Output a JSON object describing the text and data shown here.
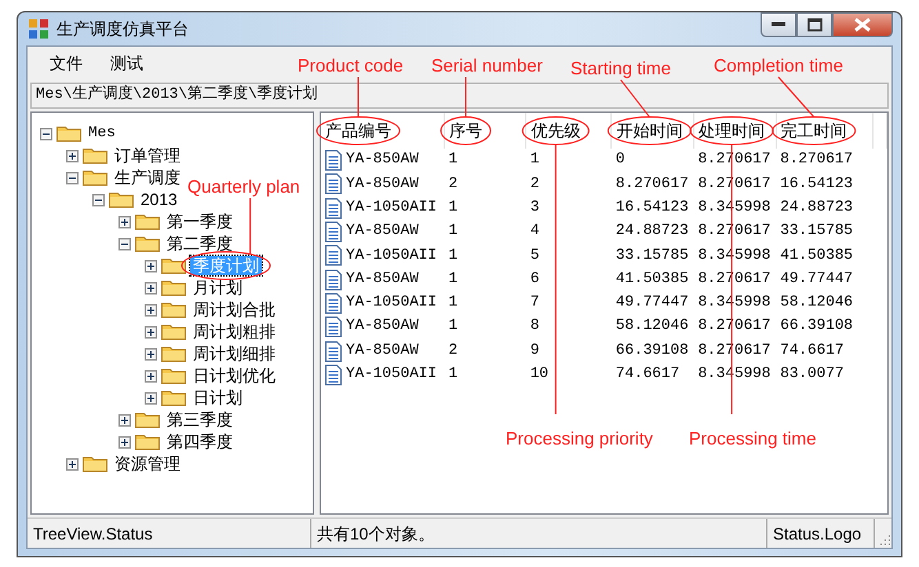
{
  "window": {
    "title": "生产调度仿真平台"
  },
  "menu": [
    "文件",
    "测试"
  ],
  "path": "Mes\\生产调度\\2013\\第二季度\\季度计划",
  "tree": [
    {
      "label": "Mes",
      "expanded": true,
      "selected": false,
      "children": [
        {
          "label": "订单管理",
          "expanded": false,
          "selected": false
        },
        {
          "label": "生产调度",
          "expanded": true,
          "selected": false,
          "children": [
            {
              "label": "2013",
              "expanded": true,
              "selected": false,
              "children": [
                {
                  "label": "第一季度",
                  "expanded": false,
                  "selected": false
                },
                {
                  "label": "第二季度",
                  "expanded": true,
                  "selected": false,
                  "children": [
                    {
                      "label": "季度计划",
                      "expanded": false,
                      "selected": true
                    },
                    {
                      "label": "月计划",
                      "expanded": false,
                      "selected": false
                    },
                    {
                      "label": "周计划合批",
                      "expanded": false,
                      "selected": false
                    },
                    {
                      "label": "周计划粗排",
                      "expanded": false,
                      "selected": false
                    },
                    {
                      "label": "周计划细排",
                      "expanded": false,
                      "selected": false
                    },
                    {
                      "label": "日计划优化",
                      "expanded": false,
                      "selected": false
                    },
                    {
                      "label": "日计划",
                      "expanded": false,
                      "selected": false
                    }
                  ]
                },
                {
                  "label": "第三季度",
                  "expanded": false,
                  "selected": false
                },
                {
                  "label": "第四季度",
                  "expanded": false,
                  "selected": false
                }
              ]
            }
          ]
        },
        {
          "label": "资源管理",
          "expanded": false,
          "selected": false
        }
      ]
    }
  ],
  "table": {
    "columns": [
      "产品编号",
      "序号",
      "优先级",
      "开始时间",
      "处理时间",
      "完工时间"
    ],
    "rows": [
      [
        "YA-850AW",
        "1",
        "1",
        "0",
        "8.270617",
        "8.270617"
      ],
      [
        "YA-850AW",
        "2",
        "2",
        "8.270617",
        "8.270617",
        "16.54123"
      ],
      [
        "YA-1050AII",
        "1",
        "3",
        "16.54123",
        "8.345998",
        "24.88723"
      ],
      [
        "YA-850AW",
        "1",
        "4",
        "24.88723",
        "8.270617",
        "33.15785"
      ],
      [
        "YA-1050AII",
        "1",
        "5",
        "33.15785",
        "8.345998",
        "41.50385"
      ],
      [
        "YA-850AW",
        "1",
        "6",
        "41.50385",
        "8.270617",
        "49.77447"
      ],
      [
        "YA-1050AII",
        "1",
        "7",
        "49.77447",
        "8.345998",
        "58.12046"
      ],
      [
        "YA-850AW",
        "1",
        "8",
        "58.12046",
        "8.270617",
        "66.39108"
      ],
      [
        "YA-850AW",
        "2",
        "9",
        "66.39108",
        "8.270617",
        "74.6617"
      ],
      [
        "YA-1050AII",
        "1",
        "10",
        "74.6617",
        "8.345998",
        "83.0077"
      ]
    ]
  },
  "status_bar": [
    "TreeView.Status",
    "共有10个对象。",
    "Status.Logo"
  ],
  "annotations": [
    {
      "text": "Product code"
    },
    {
      "text": "Serial number"
    },
    {
      "text": "Starting time"
    },
    {
      "text": "Completion time"
    },
    {
      "text": "Quarterly plan"
    },
    {
      "text": "Processing priority"
    },
    {
      "text": "Processing time"
    }
  ]
}
